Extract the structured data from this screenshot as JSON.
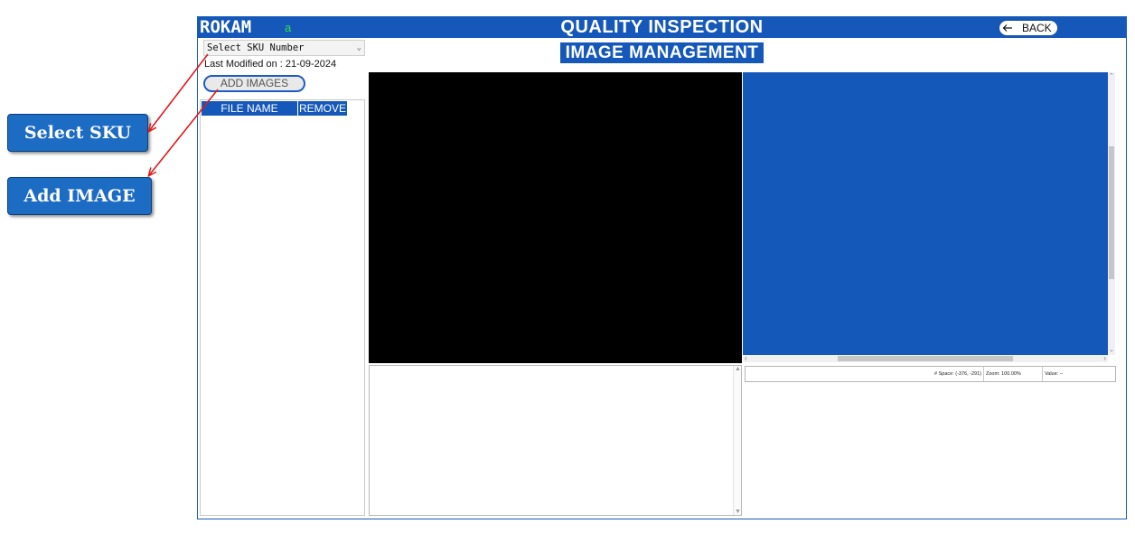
{
  "header": {
    "logo": "ROKAM",
    "user_tag": "a",
    "title": "QUALITY INSPECTION",
    "back_label": "BACK"
  },
  "page": {
    "subtitle": "IMAGE MANAGEMENT"
  },
  "sidebar": {
    "sku_select": {
      "selected": "Select SKU Number"
    },
    "last_modified": "Last Modified on : 21-09-2024",
    "add_images_label": "ADD IMAGES",
    "file_table": {
      "columns": [
        "FILE NAME",
        "REMOVE"
      ],
      "rows": []
    }
  },
  "viewer": {
    "status": {
      "space": "# Space: (-376, -291)",
      "zoom": "Zoom: 100.00%",
      "value": "Value: --"
    }
  },
  "callouts": {
    "select_sku": "Select SKU",
    "add_image": "Add IMAGE"
  },
  "colors": {
    "brand_blue": "#1558b9",
    "camera_bg": "#000000",
    "callout_bg": "#1d6cc4",
    "arrow_red": "#e01a1a",
    "user_tag_green": "#33e04f"
  },
  "icons": {
    "back": "arrow-left-icon",
    "dropdown": "chevron-down-icon"
  }
}
